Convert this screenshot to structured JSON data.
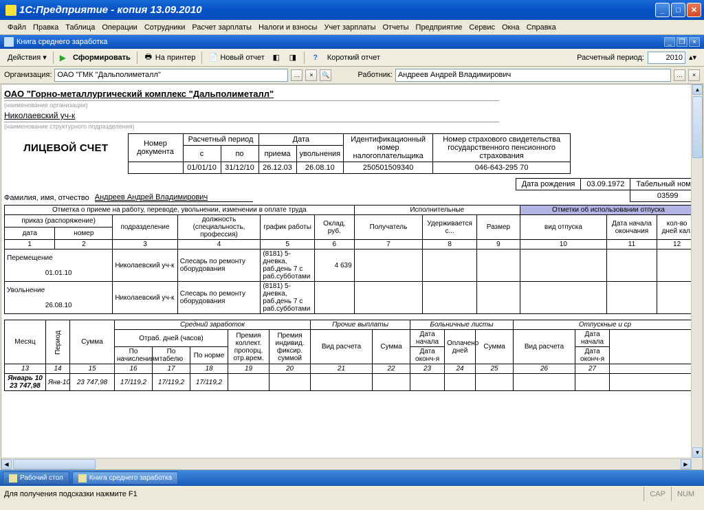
{
  "window": {
    "title": "1С:Предприятие - копия 13.09.2010"
  },
  "menu": [
    "Файл",
    "Правка",
    "Таблица",
    "Операции",
    "Сотрудники",
    "Расчет зарплаты",
    "Налоги и взносы",
    "Учет зарплаты",
    "Отчеты",
    "Предприятие",
    "Сервис",
    "Окна",
    "Справка"
  ],
  "subwindow": {
    "title": "Книга среднего заработка"
  },
  "toolbar": {
    "actions": "Действия",
    "form": "Сформировать",
    "print": "На принтер",
    "new_report": "Новый отчет",
    "short_report": "Короткий отчет",
    "period_label": "Расчетный период:",
    "period_value": "2010"
  },
  "filter": {
    "org_label": "Организация:",
    "org_value": "ОАО \"ГМК \"Дальполиметалл\"",
    "worker_label": "Работник:",
    "worker_value": "Андреев Андрей Владимирович"
  },
  "doc": {
    "org": "ОАО \"Горно-металлургический комплекс \"Дальполиметалл\"",
    "org_hint": "(наименование организации)",
    "dept": "Николаевский уч-к",
    "dept_hint": "(наименование структурного подразделения)",
    "account_title": "ЛИЦЕВОЙ СЧЕТ",
    "header_labels": {
      "docnum": "Номер документа",
      "period": "Расчетный период",
      "from": "с",
      "to": "по",
      "date": "Дата",
      "hired": "приема",
      "fired": "увольнения",
      "inn": "Идентификационный номер налогоплательщика",
      "pfr": "Номер страхового свидетельства государственного пенсионного страхования"
    },
    "header_values": {
      "docnum": "",
      "from": "01/01/10",
      "to": "31/12/10",
      "hired": "26.12.03",
      "fired": "26.08.10",
      "inn": "250501509340",
      "pfr": "046-643-295 70"
    },
    "fio_label": "Фамилия, имя, отчество",
    "fio_value": "Андреев Андрей Владимирович",
    "birth_label": "Дата рождения",
    "birth_value": "03.09.1972",
    "tabnum_label": "Табельный номер",
    "tabnum_value": "03599",
    "grid_headers": {
      "section1": "Отметка о приеме на работу, переводе, увольнении, изменении в оплате труда",
      "section2": "Исполнительные",
      "section3": "Отметки об использовании отпуска",
      "order": "приказ (распоряжение)",
      "date": "дата",
      "number": "номер",
      "dept": "подразделение",
      "position": "должность (специальность, профессия)",
      "schedule": "график работы",
      "salary": "Оклад, руб.",
      "recipient": "Получатель",
      "withheld": "Удерживается с...",
      "size": "Размер",
      "vac_type": "вид отпуска",
      "vac_start": "Дата начала окончания",
      "days": "кол-во дней кал."
    },
    "col_nums": [
      "1",
      "2",
      "3",
      "4",
      "5",
      "6",
      "7",
      "8",
      "9",
      "10",
      "11",
      "12"
    ],
    "rows": [
      {
        "op": "Перемещение",
        "date": "01.01.10",
        "dept": "Николаевский уч-к",
        "pos": "Слесарь по ремонту оборудования",
        "sched": "(8181) 5-дневка, раб.день 7 с раб.субботами",
        "salary": "4 639"
      },
      {
        "op": "Увольнение",
        "date": "26.08.10",
        "dept": "Николаевский уч-к",
        "pos": "Слесарь по ремонту оборудования",
        "sched": "(8181) 5-дневка, раб.день 7 с раб.субботами",
        "salary": ""
      }
    ],
    "summary_headers": {
      "month": "Месяц",
      "period": "Период",
      "sum": "Сумма",
      "avg": "Средний заработок",
      "worked": "Отраб. дней (часов)",
      "by_accrual": "По начислениям",
      "by_tab": "По табелю",
      "by_norm": "По норме",
      "bonus1": "Премия коллект. пропорц. отр.врем.",
      "bonus2": "Премия индивид. фиксир. суммой",
      "other": "Прочие выплаты",
      "calc_type": "Вид расчета",
      "sick": "Больничные листы",
      "start": "Дата начала",
      "end": "Дата оконч-я",
      "paid_days": "Оплачено дней",
      "vacation": "Отпускные и ср"
    },
    "col_nums2": [
      "13",
      "14",
      "15",
      "16",
      "17",
      "18",
      "19",
      "20",
      "21",
      "22",
      "23",
      "24",
      "25",
      "26",
      "27"
    ],
    "summary_row": {
      "month": "Январь 10",
      "total": "23 747,98",
      "period": "Янв-10",
      "sum": "23 747,98",
      "d1": "17/119,2",
      "d2": "17/119,2",
      "d3": "17/119,2"
    }
  },
  "taskbar": {
    "t1": "Рабочий стол",
    "t2": "Книга среднего заработка"
  },
  "status": {
    "text": "Для получения подсказки нажмите F1",
    "cap": "CAP",
    "num": "NUM"
  }
}
